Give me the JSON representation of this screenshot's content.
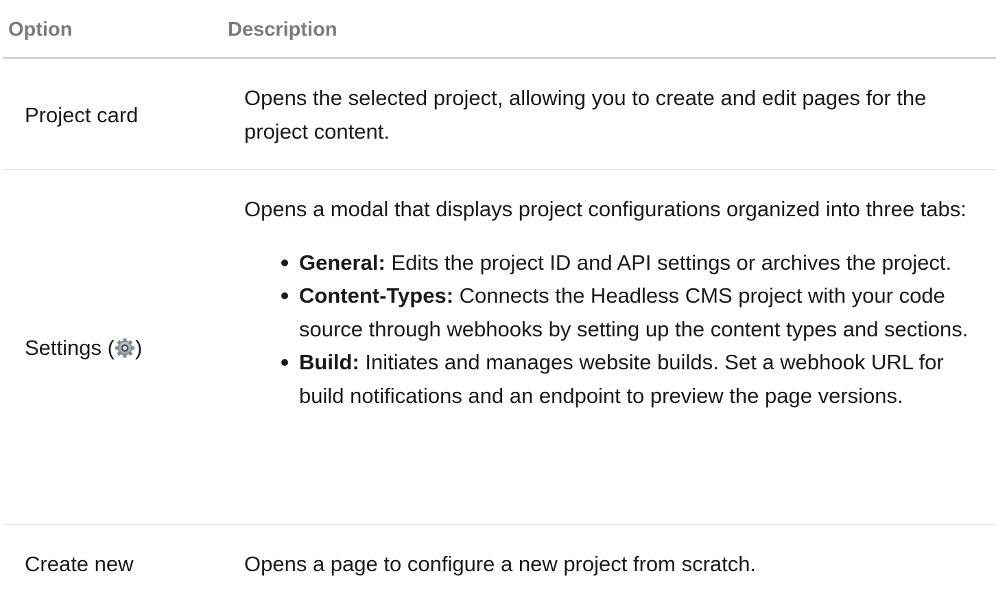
{
  "table": {
    "headers": {
      "option": "Option",
      "description": "Description"
    },
    "rows": [
      {
        "option": "Project card",
        "description": "Opens the selected project, allowing you to create and edit pages for the project content."
      },
      {
        "option_prefix": "Settings (",
        "option_suffix": ")",
        "option_icon": "gear-icon",
        "intro": "Opens a modal that displays project configurations organized into three tabs:",
        "bullets": [
          {
            "term": "General:",
            "text": " Edits the project ID and API settings or archives the project."
          },
          {
            "term": "Content-Types:",
            "text": " Connects the Headless CMS project with your code source through webhooks by setting up the content types and sections."
          },
          {
            "term": "Build:",
            "text": " Initiates and manages website builds. Set a webhook URL for build notifications and an endpoint to preview the page versions."
          }
        ]
      },
      {
        "option": "Create new",
        "description": "Opens a page to configure a new project from scratch."
      }
    ]
  }
}
